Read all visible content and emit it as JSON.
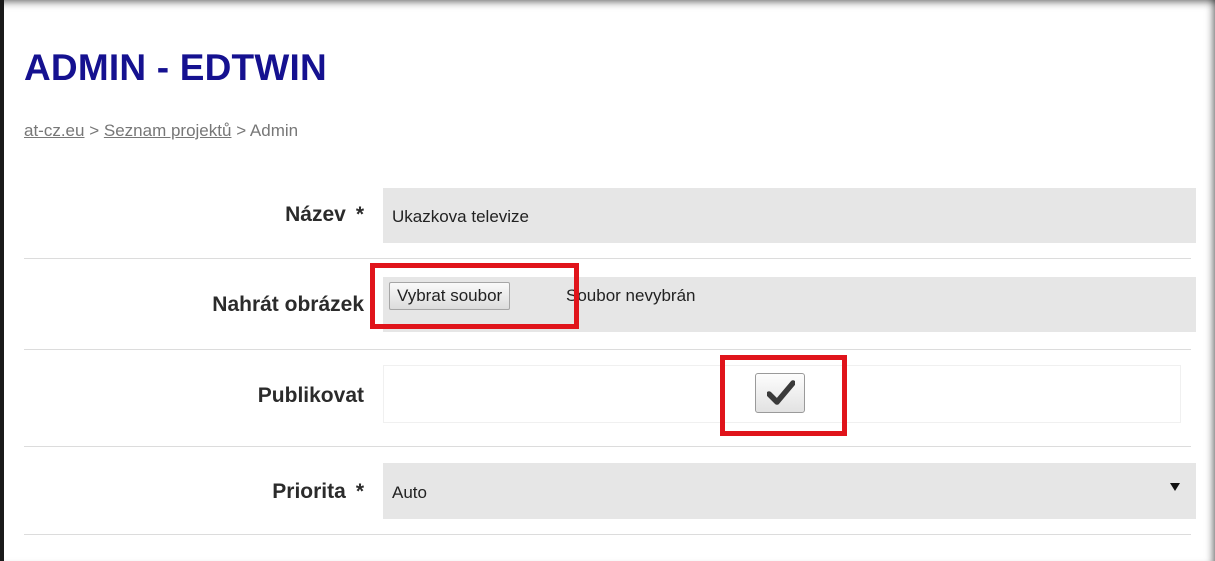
{
  "page": {
    "title": "ADMIN - EDTWIN"
  },
  "breadcrumb": {
    "home": "at-cz.eu",
    "sep1": ">",
    "projects": "Seznam projektů",
    "sep2": ">",
    "current": "Admin"
  },
  "form": {
    "nazev": {
      "label": "Název",
      "required_mark": "*",
      "value": "Ukazkova televize"
    },
    "obrazek": {
      "label": "Nahrát obrázek",
      "button_label": "Vybrat soubor",
      "status": "Soubor nevybrán"
    },
    "publikovat": {
      "label": "Publikovat",
      "checked": true
    },
    "priorita": {
      "label": "Priorita",
      "required_mark": "*",
      "selected": "Auto"
    }
  },
  "colors": {
    "title": "#151190",
    "highlight": "#e0141b",
    "field_bg": "#e6e6e6"
  }
}
